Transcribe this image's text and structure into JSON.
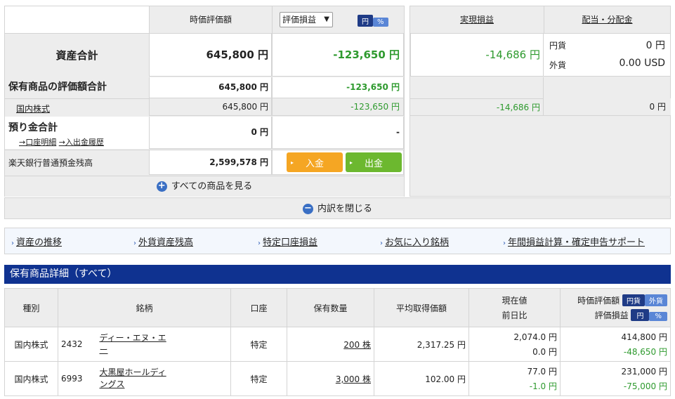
{
  "summary": {
    "header": {
      "market_value": "時価評価額",
      "dropdown_value": "評価損益",
      "yen": "円",
      "pct": "%",
      "realized": "実現損益",
      "dividend": "配当・分配金"
    },
    "total_assets": {
      "label": "資産合計",
      "market_value": "645,800 円",
      "pl": "-123,650 円",
      "realized": "-14,686 円",
      "div_yen_label": "円貨",
      "div_yen_value": "0 円",
      "div_fx_label": "外貨",
      "div_fx_value": "0.00 USD"
    },
    "holdings_total": {
      "label": "保有商品の評価額合計",
      "market_value": "645,800 円",
      "pl": "-123,650 円"
    },
    "domestic": {
      "label": "国内株式",
      "market_value": "645,800 円",
      "pl": "-123,650 円",
      "realized": "-14,686 円",
      "dividend": "0 円"
    },
    "deposits": {
      "label": "預り金合計",
      "link1": "→口座明細",
      "link2": "→入出金履歴",
      "market_value": "0 円",
      "pl": "-"
    },
    "bank": {
      "label": "楽天銀行普通預金残高",
      "market_value": "2,599,578 円",
      "deposit_btn": "入金",
      "withdraw_btn": "出金"
    },
    "show_all": "すべての商品を見る",
    "close_breakdown": "内訳を閉じる"
  },
  "nav": [
    "資産の推移",
    "外貨資産残高",
    "特定口座損益",
    "お気に入り銘柄",
    "年間損益計算・確定申告サポート"
  ],
  "detail": {
    "title": "保有商品詳細（すべて）",
    "columns": {
      "type": "種別",
      "name": "銘柄",
      "account": "口座",
      "qty": "保有数量",
      "avg": "平均取得価額",
      "price": "現在値",
      "change": "前日比",
      "mv": "時価評価額",
      "pl": "評価損益",
      "yen": "円貨",
      "fx": "外貨",
      "yen2": "円",
      "pct": "%"
    },
    "rows": [
      {
        "type": "国内株式",
        "code": "2432",
        "name_1": "ディー・エヌ・エ",
        "name_2": "ー",
        "account": "特定",
        "qty": "200 株",
        "avg": "2,317.25 円",
        "price": "2,074.0 円",
        "change": "0.0 円",
        "mv": "414,800 円",
        "pl": "-48,650 円"
      },
      {
        "type": "国内株式",
        "code": "6993",
        "name_1": "大黒屋ホールディ",
        "name_2": "ングス",
        "account": "特定",
        "qty": "3,000 株",
        "avg": "102.00 円",
        "price": "77.0 円",
        "change": "-1.0 円",
        "mv": "231,000 円",
        "pl": "-75,000 円"
      }
    ]
  },
  "colors": {
    "header_blue": "#0f3290",
    "green": "#2e9a2e",
    "orange_btn": "#f5a623",
    "green_btn": "#6cb82f"
  }
}
